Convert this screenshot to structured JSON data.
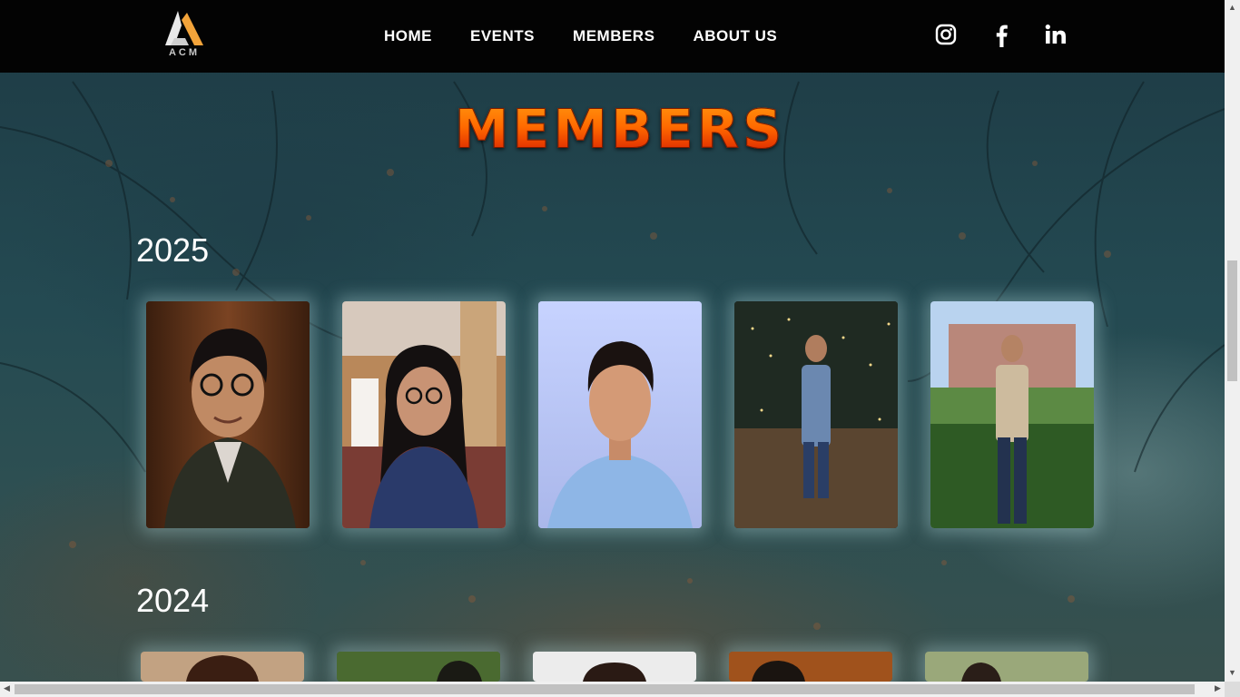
{
  "nav": {
    "logo_text": "ACM",
    "links": [
      "HOME",
      "EVENTS",
      "MEMBERS",
      "ABOUT US"
    ],
    "social_icons": [
      "instagram-icon",
      "facebook-icon",
      "linkedin-icon"
    ]
  },
  "page": {
    "title": "MEMBERS"
  },
  "sections": [
    {
      "year": "2025",
      "member_count_visible": 5
    },
    {
      "year": "2024",
      "member_count_visible": 5
    }
  ],
  "colors": {
    "navbar": "#030303",
    "title_gradient_top": "#ff9a10",
    "title_gradient_bottom": "#b51c00",
    "logo_accent": "#f2a33a"
  }
}
